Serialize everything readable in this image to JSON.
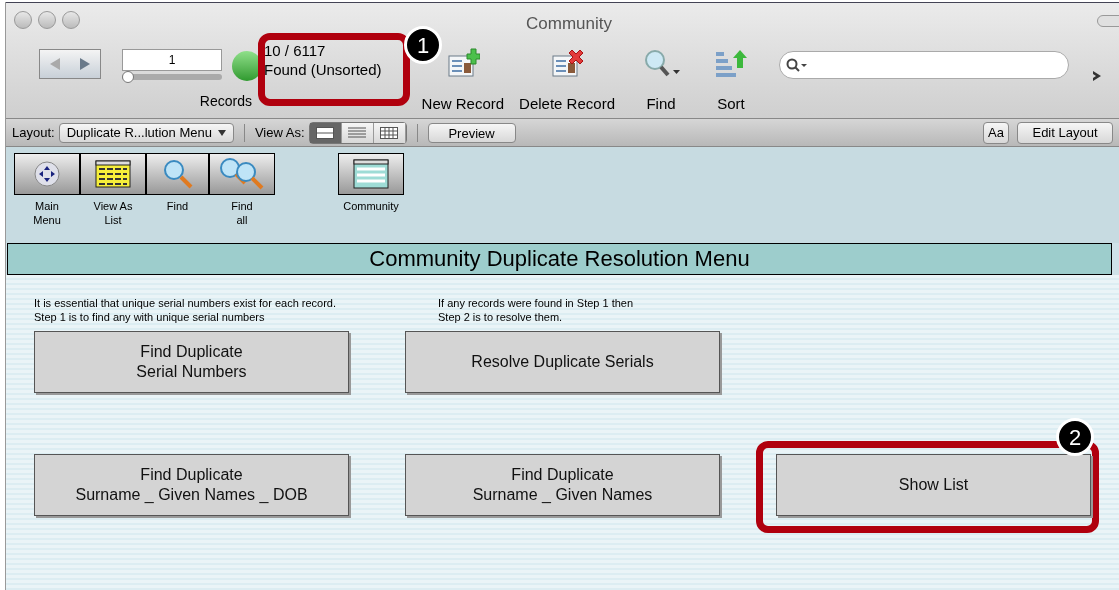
{
  "window": {
    "title": "Community"
  },
  "toolbar": {
    "record_number": "1",
    "record_slider": {
      "level": 0
    },
    "records_label": "Records",
    "found_count": "10 / 6117",
    "found_status": "Found (Unsorted)",
    "actions": [
      {
        "kind": "new",
        "label": "New Record"
      },
      {
        "kind": "delete",
        "label": "Delete Record"
      },
      {
        "kind": "find",
        "label": "Find"
      },
      {
        "kind": "sort",
        "label": "Sort"
      }
    ]
  },
  "layout_bar": {
    "layout_label": "Layout:",
    "layout_value": "Duplicate R...lution Menu",
    "view_as_label": "View As:",
    "view_modes": [
      {
        "kind": "form",
        "selected": true
      },
      {
        "kind": "list",
        "selected": false
      },
      {
        "kind": "table",
        "selected": false
      }
    ],
    "preview": "Preview",
    "text_format": "Aa",
    "edit_layout": "Edit Layout"
  },
  "nav_buttons": [
    {
      "kind": "menu",
      "label": "Main\nMenu"
    },
    {
      "kind": "list",
      "label": "View As\nList"
    },
    {
      "kind": "find",
      "label": "Find"
    },
    {
      "kind": "find_all",
      "label": "Find\nall"
    },
    {
      "kind": "community",
      "label": "Community"
    }
  ],
  "header": "Community Duplicate Resolution Menu",
  "notes": [
    "It is essential that unique serial numbers exist for each record.\nStep 1 is to find any with unique serial numbers",
    "If any records were found in  Step 1 then\nStep 2 is to resolve them."
  ],
  "buttons": [
    {
      "label": "Find Duplicate\nSerial Numbers",
      "highlighted": false
    },
    {
      "label": "Resolve Duplicate Serials",
      "highlighted": false
    },
    {
      "label": "Find Duplicate\nSurname _ Given Names _ DOB",
      "highlighted": false
    },
    {
      "label": "Find Duplicate\nSurname _ Given Names",
      "highlighted": false
    },
    {
      "label": "Show List",
      "highlighted": true
    }
  ],
  "callouts": [
    "1",
    "2"
  ]
}
